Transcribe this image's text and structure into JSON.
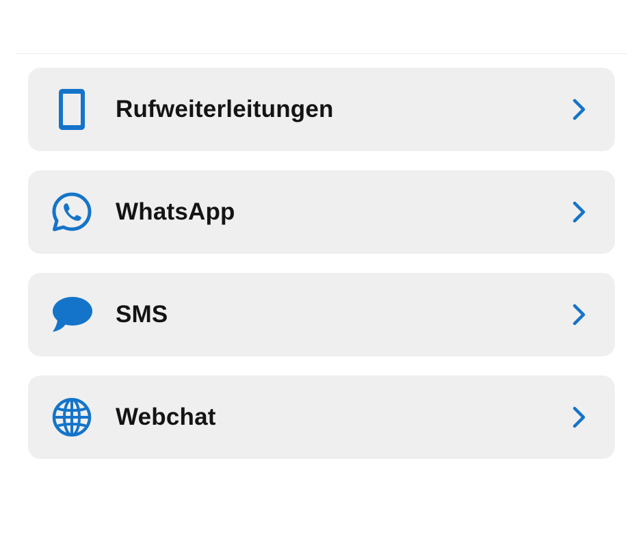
{
  "accent_color": "#1474c9",
  "menu": {
    "items": [
      {
        "label": "Rufweiterleitungen",
        "icon": "smartphone-icon"
      },
      {
        "label": "WhatsApp",
        "icon": "whatsapp-icon"
      },
      {
        "label": "SMS",
        "icon": "speech-bubble-icon"
      },
      {
        "label": "Webchat",
        "icon": "globe-icon"
      }
    ]
  }
}
